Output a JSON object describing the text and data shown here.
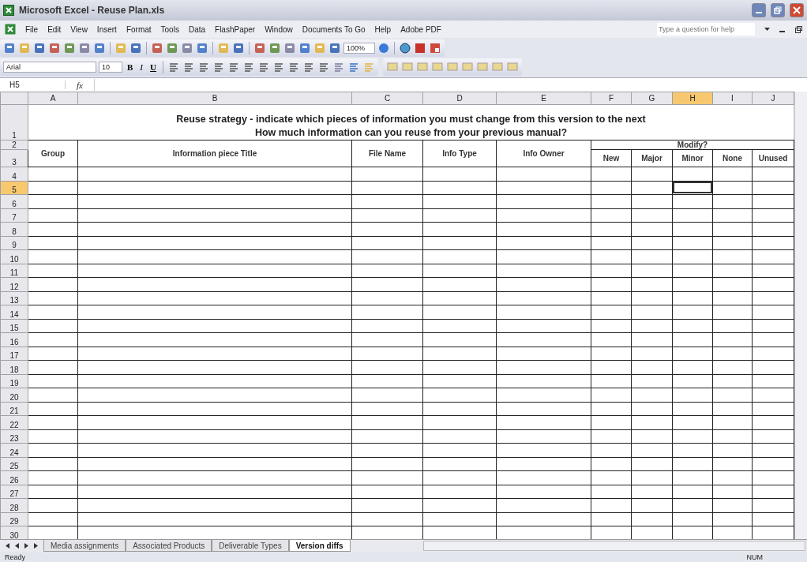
{
  "window": {
    "title": "Microsoft Excel - Reuse Plan.xls"
  },
  "menu": [
    "File",
    "Edit",
    "View",
    "Insert",
    "Format",
    "Tools",
    "Data",
    "FlashPaper",
    "Window",
    "Documents To Go",
    "Help",
    "Adobe PDF"
  ],
  "help_box": {
    "placeholder": "Type a question for help"
  },
  "standard_toolbar": {
    "zoom": "100%"
  },
  "formatting_toolbar": {
    "font": "Arial",
    "size": "10",
    "bold": "B",
    "italic": "I",
    "underline": "U"
  },
  "formula_bar": {
    "name_box": "H5",
    "fx": "fx"
  },
  "columns": [
    {
      "label": "A",
      "selected": false
    },
    {
      "label": "B",
      "selected": false
    },
    {
      "label": "C",
      "selected": false
    },
    {
      "label": "D",
      "selected": false
    },
    {
      "label": "E",
      "selected": false
    },
    {
      "label": "F",
      "selected": false
    },
    {
      "label": "G",
      "selected": false
    },
    {
      "label": "H",
      "selected": true
    },
    {
      "label": "I",
      "selected": false
    },
    {
      "label": "J",
      "selected": false
    }
  ],
  "rows": [
    {
      "label": "1",
      "selected": false
    },
    {
      "label": "2",
      "selected": false
    },
    {
      "label": "3",
      "selected": false
    },
    {
      "label": "4",
      "selected": false
    },
    {
      "label": "5",
      "selected": true
    },
    {
      "label": "6",
      "selected": false
    },
    {
      "label": "7",
      "selected": false
    },
    {
      "label": "8",
      "selected": false
    },
    {
      "label": "9",
      "selected": false
    },
    {
      "label": "10",
      "selected": false
    },
    {
      "label": "11",
      "selected": false
    },
    {
      "label": "12",
      "selected": false
    },
    {
      "label": "13",
      "selected": false
    },
    {
      "label": "14",
      "selected": false
    },
    {
      "label": "15",
      "selected": false
    },
    {
      "label": "16",
      "selected": false
    },
    {
      "label": "17",
      "selected": false
    },
    {
      "label": "18",
      "selected": false
    },
    {
      "label": "19",
      "selected": false
    },
    {
      "label": "20",
      "selected": false
    },
    {
      "label": "21",
      "selected": false
    },
    {
      "label": "22",
      "selected": false
    },
    {
      "label": "23",
      "selected": false
    },
    {
      "label": "24",
      "selected": false
    },
    {
      "label": "25",
      "selected": false
    },
    {
      "label": "26",
      "selected": false
    },
    {
      "label": "27",
      "selected": false
    },
    {
      "label": "28",
      "selected": false
    },
    {
      "label": "29",
      "selected": false
    },
    {
      "label": "30",
      "selected": false
    }
  ],
  "sheet": {
    "title_lines": [
      "Reuse strategy - indicate which pieces of information you must change from this version to the next",
      "How much information can you reuse from your previous manual?"
    ],
    "headers": [
      "Group",
      "Information piece Title",
      "File Name",
      "Info Type",
      "Info Owner"
    ],
    "group_header": "Modify?",
    "sub_headers": [
      "New",
      "Major",
      "Minor",
      "None",
      "Unused"
    ]
  },
  "sheet_tabs": [
    {
      "label": "Media assignments",
      "selected": false
    },
    {
      "label": "Associated Products",
      "selected": false
    },
    {
      "label": "Deliverable Types",
      "selected": false
    },
    {
      "label": "Version diffs",
      "selected": true
    }
  ],
  "status_bar": {
    "status": "Ready",
    "indicator": "NUM"
  }
}
